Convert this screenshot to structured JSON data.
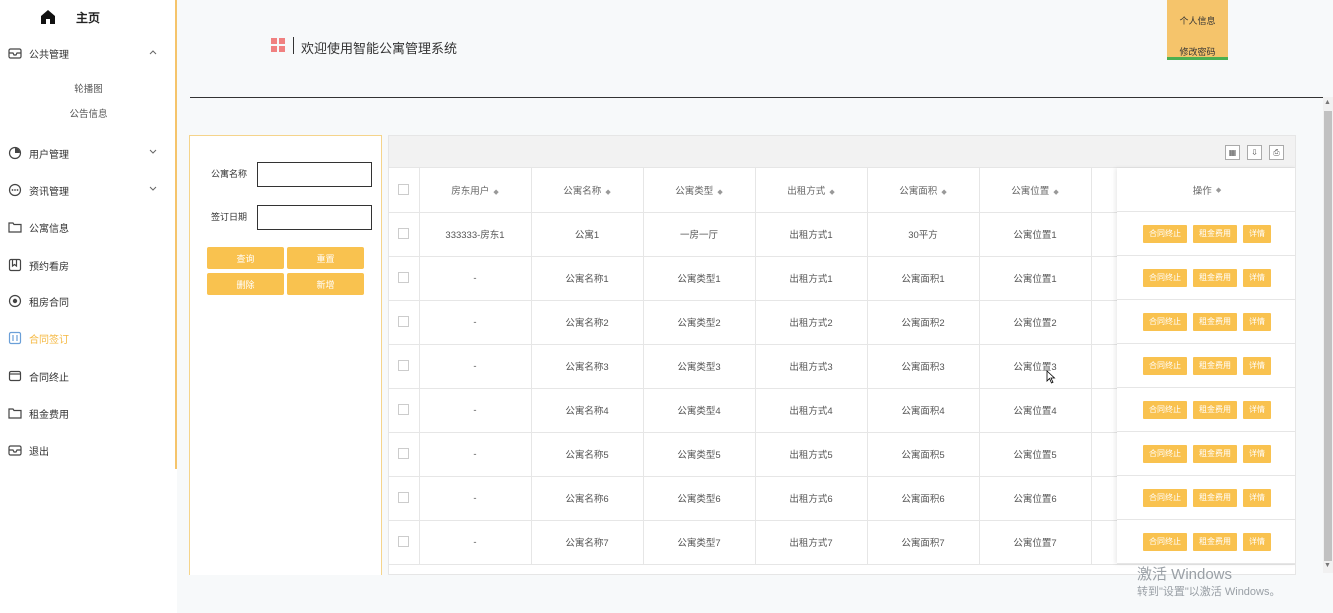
{
  "sidebar": {
    "home_label": "主页",
    "groups": [
      {
        "label": "公共管理",
        "icon": "mail-icon",
        "expanded": true,
        "children": [
          "轮播图",
          "公告信息"
        ]
      },
      {
        "label": "用户管理",
        "icon": "clock-icon",
        "expanded": false
      },
      {
        "label": "资讯管理",
        "icon": "dots-circle-icon",
        "expanded": false
      },
      {
        "label": "公寓信息",
        "icon": "folder-icon"
      },
      {
        "label": "预约看房",
        "icon": "bookmark-icon"
      },
      {
        "label": "租房合同",
        "icon": "record-icon"
      },
      {
        "label": "合同签订",
        "icon": "calendar-icon",
        "active": true
      },
      {
        "label": "合同终止",
        "icon": "wallet-icon"
      },
      {
        "label": "租金费用",
        "icon": "folder-icon"
      },
      {
        "label": "退出",
        "icon": "mail-icon"
      }
    ]
  },
  "header": {
    "title": "欢迎使用智能公寓管理系统",
    "user_menu": [
      "个人信息",
      "修改密码"
    ]
  },
  "search": {
    "fields": [
      {
        "label": "公寓名称",
        "value": ""
      },
      {
        "label": "签订日期",
        "value": ""
      }
    ],
    "buttons": [
      "查询",
      "重置",
      "删除",
      "新增"
    ]
  },
  "table": {
    "columns": [
      "房东用户",
      "公寓名称",
      "公寓类型",
      "出租方式",
      "公寓面积",
      "公寓位置"
    ],
    "op_column": "操作",
    "row_actions": [
      "合同终止",
      "租金费用",
      "详情"
    ],
    "rows": [
      [
        "333333-房东1",
        "公寓1",
        "一房一厅",
        "出租方式1",
        "30平方",
        "公寓位置1"
      ],
      [
        "-",
        "公寓名称1",
        "公寓类型1",
        "出租方式1",
        "公寓面积1",
        "公寓位置1"
      ],
      [
        "-",
        "公寓名称2",
        "公寓类型2",
        "出租方式2",
        "公寓面积2",
        "公寓位置2"
      ],
      [
        "-",
        "公寓名称3",
        "公寓类型3",
        "出租方式3",
        "公寓面积3",
        "公寓位置3"
      ],
      [
        "-",
        "公寓名称4",
        "公寓类型4",
        "出租方式4",
        "公寓面积4",
        "公寓位置4"
      ],
      [
        "-",
        "公寓名称5",
        "公寓类型5",
        "出租方式5",
        "公寓面积5",
        "公寓位置5"
      ],
      [
        "-",
        "公寓名称6",
        "公寓类型6",
        "出租方式6",
        "公寓面积6",
        "公寓位置6"
      ],
      [
        "-",
        "公寓名称7",
        "公寓类型7",
        "出租方式7",
        "公寓面积7",
        "公寓位置7"
      ]
    ]
  },
  "watermark": {
    "line1": "激活 Windows",
    "line2": "转到\"设置\"以激活 Windows。"
  },
  "colors": {
    "accent": "#f9c24f",
    "sidebar_border": "#f5c46b",
    "header_icon": "#f08080",
    "user_box_underline": "#4caf50"
  }
}
